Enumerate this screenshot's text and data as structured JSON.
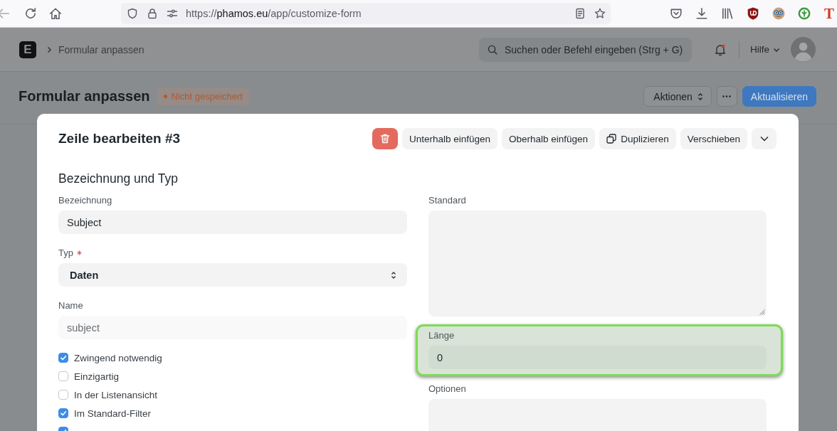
{
  "browser": {
    "url": {
      "scheme": "https://",
      "host": "phamos.eu",
      "path": "/app/customize-form"
    },
    "extension_label": "T"
  },
  "navbar": {
    "logo": "E",
    "breadcrumb": "Formular anpassen",
    "search": {
      "placeholder": "Suchen oder Befehl eingeben (Strg + G)"
    },
    "unread": true,
    "help": "Hilfe"
  },
  "page_head": {
    "title": "Formular anpassen",
    "indicator": "Nicht gespeichert",
    "buttons": [
      {
        "kind": "dropdown",
        "label": "Aktionen"
      },
      {
        "kind": "more"
      },
      {
        "kind": "primary",
        "label": "Aktualisieren"
      }
    ]
  },
  "dialog": {
    "title": "Zeile bearbeiten #3",
    "buttons": [
      {
        "kind": "delete"
      },
      {
        "kind": "text",
        "label": "Unterhalb einfügen"
      },
      {
        "kind": "text",
        "label": "Oberhalb einfügen"
      },
      {
        "kind": "duplicate",
        "label": "Duplizieren"
      },
      {
        "kind": "text",
        "label": "Verschieben"
      },
      {
        "kind": "menu"
      }
    ],
    "section": {
      "title": "Bezeichnung und Typ",
      "columns": [
        {
          "fields": [
            {
              "kind": "input",
              "label": "Bezeichnung",
              "value": "Subject",
              "required": false,
              "readonly": false,
              "highlighted": false
            },
            {
              "kind": "select",
              "label": "Typ",
              "value": "Daten",
              "required": true,
              "readonly": false,
              "highlighted": false
            },
            {
              "kind": "input",
              "label": "Name",
              "value": "subject",
              "required": false,
              "readonly": true,
              "highlighted": false
            }
          ],
          "checkboxes": [
            {
              "label": "Zwingend notwendig",
              "checked": true
            },
            {
              "label": "Einzigartig",
              "checked": false
            },
            {
              "label": "In der Listenansicht",
              "checked": false
            },
            {
              "label": "Im Standard-Filter",
              "checked": true
            },
            {
              "checked": true
            }
          ]
        },
        {
          "fields": [
            {
              "kind": "textarea",
              "label": "Standard",
              "required": false,
              "readonly": false,
              "highlighted": false
            },
            {
              "kind": "input",
              "label": "Länge",
              "value": "0",
              "required": false,
              "readonly": false,
              "highlighted": true
            },
            {
              "kind": "textarea",
              "label": "Optionen",
              "required": false,
              "readonly": false,
              "highlighted": false
            }
          ]
        }
      ]
    }
  }
}
